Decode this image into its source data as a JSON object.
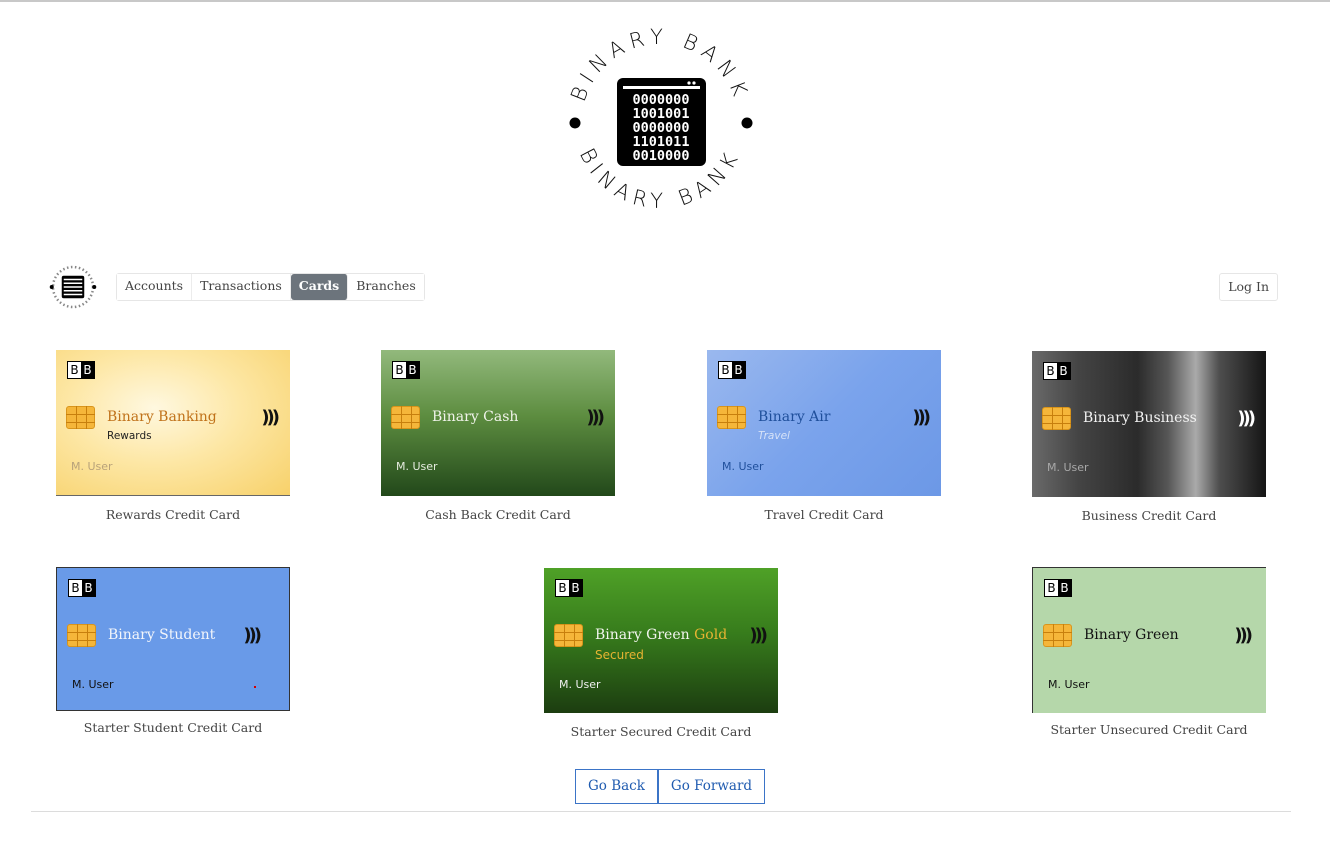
{
  "brand": {
    "ring_top": "BINARY BANK",
    "ring_bottom": "BINARY BANK",
    "binary_rows": [
      "0000000",
      "1001001",
      "0000000",
      "1101011",
      "0010000"
    ]
  },
  "nav": {
    "items": [
      "Accounts",
      "Transactions",
      "Cards",
      "Branches"
    ],
    "active": "Cards",
    "login": "Log In"
  },
  "card_mark": {
    "left": "B",
    "right": "B"
  },
  "cards": [
    {
      "name": "Binary Banking",
      "sub": "Rewards",
      "holder": "M. User",
      "caption": "Rewards Credit Card"
    },
    {
      "name": "Binary Cash",
      "sub": "",
      "holder": "M. User",
      "caption": "Cash Back Credit Card"
    },
    {
      "name": "Binary Air",
      "sub": "Travel",
      "holder": "M. User",
      "caption": "Travel Credit Card"
    },
    {
      "name": "Binary Business",
      "sub": "",
      "holder": "M. User",
      "caption": "Business Credit Card"
    },
    {
      "name": "Binary Student",
      "sub": "",
      "holder": "M. User",
      "caption": "Starter Student Credit Card"
    },
    {
      "name": "Binary Green",
      "name_accent": "Gold",
      "sub": "Secured",
      "holder": "M. User",
      "caption": "Starter Secured Credit Card"
    },
    {
      "name": "Binary Green",
      "sub": "",
      "holder": "M. User",
      "caption": "Starter Unsecured Credit Card"
    }
  ],
  "contactless_symbol": ")))",
  "pager": {
    "back": "Go Back",
    "forward": "Go Forward"
  }
}
